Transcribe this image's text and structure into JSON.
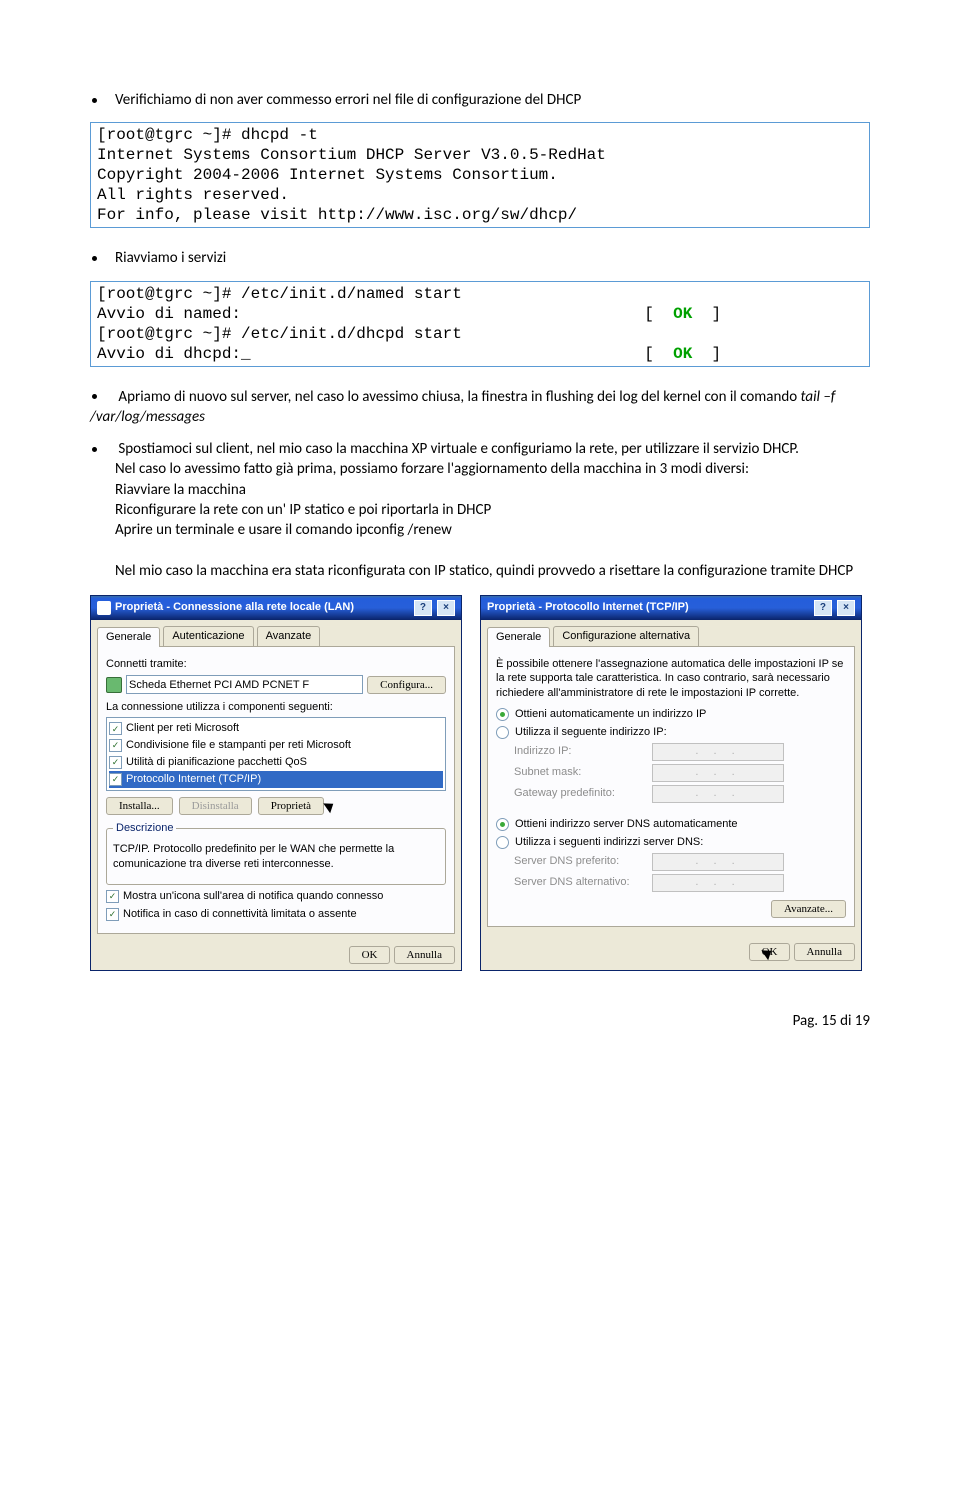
{
  "bullets": {
    "b1": "Verifichiamo di non aver commesso errori nel file di configurazione del DHCP",
    "b2": "Riavviamo i servizi",
    "b3a": "Apriamo di nuovo sul server, nel caso lo avessimo chiusa, la finestra in flushing dei log del kernel con il comando",
    "b3cmd": "tail –f  /var/log/messages",
    "b4a": "Spostiamoci sul client, nel mio caso la macchina XP virtuale e configuriamo la  rete, per utilizzare il servizio DHCP.",
    "b4b": "Nel caso lo avessimo fatto già prima, possiamo forzare l'aggiornamento della macchina in 3 modi diversi:",
    "b4c": "Riavviare la macchina",
    "b4d": "Riconfigurare la rete con un' IP statico e poi riportarla in DHCP",
    "b4e": "Aprire un terminale e usare il comando   ipconfig /renew",
    "b4f": "Nel mio caso la macchina era stata riconfigurata con IP statico, quindi provvedo a risettare la configurazione tramite DHCP"
  },
  "code1": {
    "l1": "[root@tgrc ~]# dhcpd -t",
    "l2": "Internet Systems Consortium DHCP Server V3.0.5-RedHat",
    "l3": "Copyright 2004-2006 Internet Systems Consortium.",
    "l4": "All rights reserved.",
    "l5": "For info, please visit http://www.isc.org/sw/dhcp/"
  },
  "code2": {
    "l1": "[root@tgrc ~]# /etc/init.d/named start",
    "l2a": "Avvio di named:",
    "l2ok": "OK",
    "l3": "[root@tgrc ~]# /etc/init.d/dhcpd start",
    "l4a": "Avvio di dhcpd:",
    "l4ok": "OK",
    "bracket_l": "[",
    "bracket_r": "]"
  },
  "win1": {
    "title": "Proprietà - Connessione alla rete locale (LAN)",
    "tab1": "Generale",
    "tab2": "Autenticazione",
    "tab3": "Avanzate",
    "connect_via": "Connetti tramite:",
    "nic": "Scheda Ethernet PCI AMD PCNET F",
    "configure": "Configura...",
    "uses_components": "La connessione utilizza i componenti seguenti:",
    "items": {
      "i1": "Client per reti Microsoft",
      "i2": "Condivisione file e stampanti per reti Microsoft",
      "i3": "Utilità di pianificazione pacchetti QoS",
      "i4": "Protocollo Internet (TCP/IP)"
    },
    "install": "Installa...",
    "uninstall": "Disinstalla",
    "properties": "Proprietà",
    "desc_legend": "Descrizione",
    "desc": "TCP/IP. Protocollo predefinito per le WAN  che permette la comunicazione tra diverse reti interconnesse.",
    "cb1": "Mostra un'icona sull'area di notifica quando connesso",
    "cb2": "Notifica in caso di connettività limitata o assente",
    "ok": "OK",
    "cancel": "Annulla"
  },
  "win2": {
    "title": "Proprietà - Protocollo Internet (TCP/IP)",
    "tab1": "Generale",
    "tab2": "Configurazione alternativa",
    "intro": "È possibile ottenere l'assegnazione automatica delle impostazioni IP se la rete supporta tale caratteristica. In caso contrario, sarà necessario richiedere all'amministratore di rete le impostazioni IP corrette.",
    "r1": "Ottieni automaticamente un indirizzo IP",
    "r2": "Utilizza il seguente indirizzo IP:",
    "ip": "Indirizzo IP:",
    "mask": "Subnet mask:",
    "gw": "Gateway predefinito:",
    "r3": "Ottieni indirizzo server DNS automaticamente",
    "r4": "Utilizza i seguenti indirizzi server DNS:",
    "dns1": "Server DNS preferito:",
    "dns2": "Server DNS alternativo:",
    "advanced": "Avanzate...",
    "ok": "OK",
    "cancel": "Annulla"
  },
  "footer": "Pag. 15 di 19"
}
